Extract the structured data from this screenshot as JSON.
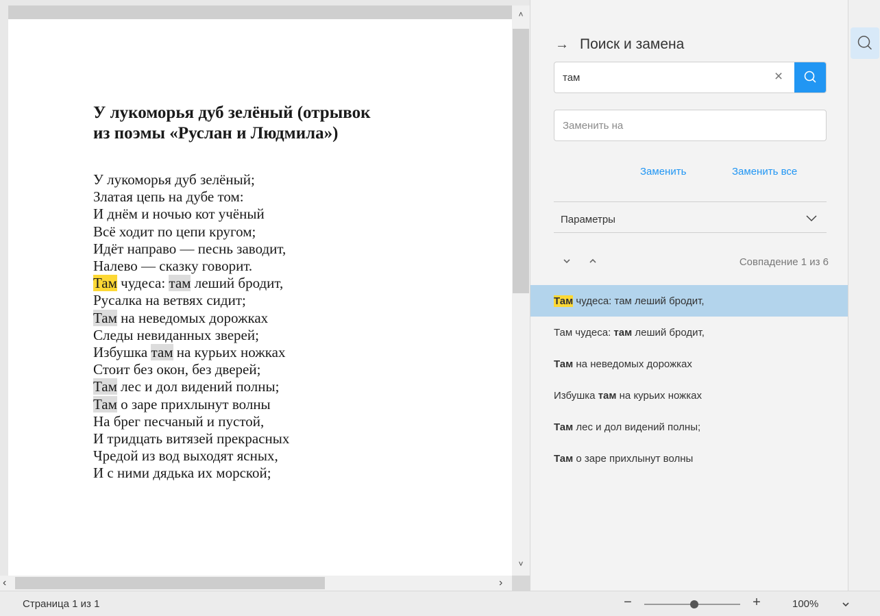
{
  "document": {
    "title_line1": "У лукоморья дуб зелёный (отрывок",
    "title_line2": "из поэмы «Руслан и Людмила»)",
    "lines": [
      {
        "pre": "У лукоморья дуб зелёный;"
      },
      {
        "pre": "Златая цепь на дубе том:"
      },
      {
        "pre": "И днём и ночью кот учёный"
      },
      {
        "pre": "Всё ходит по цепи кругом;"
      },
      {
        "pre": "Идёт направо — песнь заводит,"
      },
      {
        "pre": "Налево — сказку говорит."
      },
      {
        "pre": "",
        "match": "Там",
        "post": " чудеса: ",
        "current": true,
        "match2": "там",
        "post2": " леший бродит,"
      },
      {
        "pre": "Русалка на ветвях сидит;"
      },
      {
        "pre": "",
        "match": "Там",
        "post": " на неведомых дорожках"
      },
      {
        "pre": "Следы невиданных зверей;"
      },
      {
        "pre": "Избушка ",
        "match": "там",
        "post": " на курьих ножках"
      },
      {
        "pre": "Стоит без окон, без дверей;"
      },
      {
        "pre": "",
        "match": "Там",
        "post": " лес и дол видений полны;"
      },
      {
        "pre": "",
        "match": "Там",
        "post": " о заре прихлынут волны"
      },
      {
        "pre": "На брег песчаный и пустой,"
      },
      {
        "pre": "И тридцать витязей прекрасных"
      },
      {
        "pre": "Чредой из вод выходят ясных,"
      },
      {
        "pre": "И с ними дядька их морской;"
      }
    ]
  },
  "panel": {
    "title": "Поиск и замена",
    "search_value": "там",
    "replace_placeholder": "Заменить на",
    "replace_label": "Заменить",
    "replace_all_label": "Заменить все",
    "params_label": "Параметры",
    "match_counter": "Совпадение 1 из 6",
    "accent_color": "#2196f3",
    "results": [
      {
        "pre": "",
        "match": "Там",
        "post": " чудеса: там леший бродит,",
        "active": true
      },
      {
        "pre": "Там чудеса: ",
        "match": "там",
        "post": " леший бродит,"
      },
      {
        "pre": "",
        "match": "Там",
        "post": " на неведомых дорожках"
      },
      {
        "pre": "Избушка ",
        "match": "там",
        "post": " на курьих ножках"
      },
      {
        "pre": "",
        "match": "Там",
        "post": " лес и дол видений полны;"
      },
      {
        "pre": "",
        "match": "Там",
        "post": " о заре прихлынут волны"
      }
    ]
  },
  "icons": [
    "arrow-right-icon",
    "close-icon",
    "search-icon",
    "chevron-down-icon",
    "chevron-up-icon"
  ],
  "statusbar": {
    "page_info": "Страница 1 из 1",
    "zoom_value": "100%",
    "zoom_out_label": "−",
    "zoom_in_label": "+"
  }
}
